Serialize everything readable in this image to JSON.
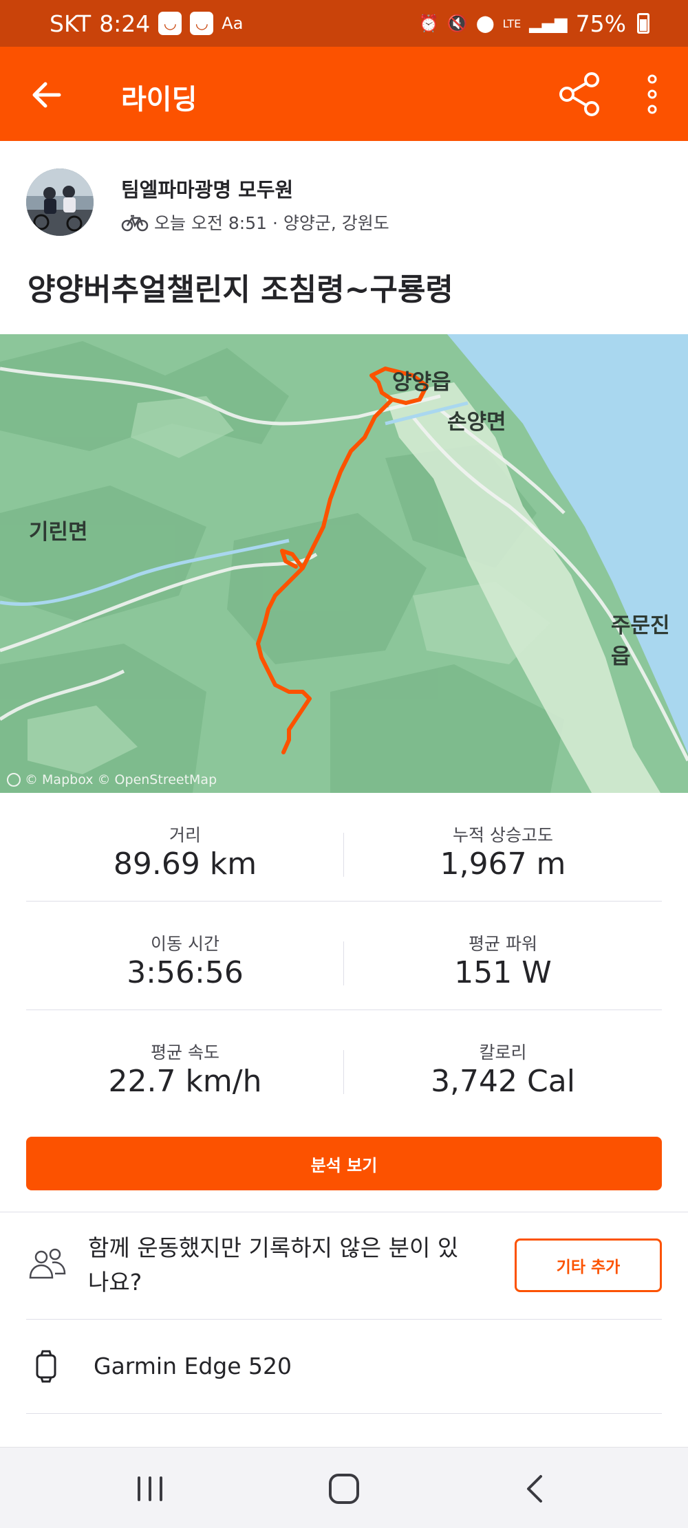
{
  "status_bar": {
    "carrier": "SKT",
    "time": "8:24",
    "network": "LTE",
    "battery": "75%"
  },
  "app_bar": {
    "title": "라이딩",
    "icons": [
      "back-arrow-icon",
      "share-icon",
      "more-vertical-icon"
    ]
  },
  "activity": {
    "athlete_name": "팀엘파마광명 모두원",
    "meta": "오늘 오전 8:51 · 양양군, 강원도",
    "title": "양양버추얼챌린지 조침령~구룡령"
  },
  "map": {
    "labels": {
      "yangyang": "양양읍",
      "sonyang": "손양면",
      "girin": "기린면",
      "jumunjin": "주문진읍"
    },
    "attribution": "© Mapbox © OpenStreetMap",
    "route_color": "#fc5200"
  },
  "stats": {
    "distance": {
      "label": "거리",
      "value": "89.69 km"
    },
    "elevation": {
      "label": "누적 상승고도",
      "value": "1,967 m"
    },
    "moving_time": {
      "label": "이동 시간",
      "value": "3:56:56"
    },
    "avg_power": {
      "label": "평균 파워",
      "value": "151 W"
    },
    "avg_speed": {
      "label": "평균 속도",
      "value": "22.7 km/h"
    },
    "calories": {
      "label": "칼로리",
      "value": "3,742 Cal"
    }
  },
  "analysis_button": "분석 보기",
  "together": {
    "text": "함께 운동했지만 기록하지 않은 분이 있나요?",
    "button": "기타 추가"
  },
  "device": {
    "name": "Garmin Edge 520"
  },
  "colors": {
    "brand": "#fc5200",
    "status_bar": "#c9430a"
  }
}
